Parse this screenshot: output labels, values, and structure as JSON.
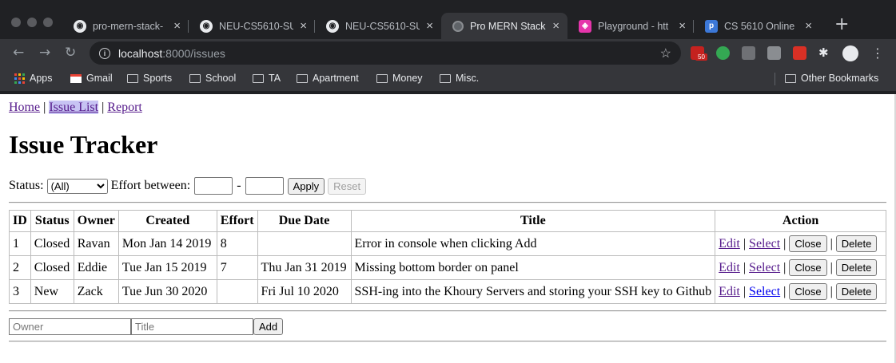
{
  "browser": {
    "tabs": [
      {
        "title": "pro-mern-stack-",
        "favicon": "github-icon",
        "active": false
      },
      {
        "title": "NEU-CS5610-SU",
        "favicon": "github-icon",
        "active": false
      },
      {
        "title": "NEU-CS5610-SU",
        "favicon": "github-icon",
        "active": false
      },
      {
        "title": "Pro MERN Stack",
        "favicon": "globe-icon",
        "active": true
      },
      {
        "title": "Playground - htt",
        "favicon": "graphql-icon",
        "active": false
      },
      {
        "title": "CS 5610 Online",
        "favicon": "piazza-icon",
        "active": false
      }
    ],
    "tab_close_glyph": "×",
    "new_tab_glyph": "+",
    "url_host": "localhost",
    "url_rest": ":8000/issues",
    "extension_badge": "50",
    "bookmarks": [
      {
        "label": "Apps",
        "icon": "apps-icon"
      },
      {
        "label": "Gmail",
        "icon": "gmail-icon"
      },
      {
        "label": "Sports",
        "icon": "folder-icon"
      },
      {
        "label": "School",
        "icon": "folder-icon"
      },
      {
        "label": "TA",
        "icon": "folder-icon"
      },
      {
        "label": "Apartment",
        "icon": "folder-icon"
      },
      {
        "label": "Money",
        "icon": "folder-icon"
      },
      {
        "label": "Misc.",
        "icon": "folder-icon"
      }
    ],
    "other_bookmarks": "Other Bookmarks",
    "colors": {
      "chrome_dark": "#202124",
      "toolbar": "#35363a"
    }
  },
  "page": {
    "nav": {
      "home": "Home",
      "sep1": "|",
      "issue_list": "Issue List",
      "sep2": "|",
      "report": "Report"
    },
    "title": "Issue Tracker",
    "filter": {
      "status_label": "Status:",
      "status_value": "(All)",
      "effort_label": "Effort between:",
      "dash": "-",
      "apply": "Apply",
      "reset": "Reset"
    },
    "table": {
      "headers": [
        "ID",
        "Status",
        "Owner",
        "Created",
        "Effort",
        "Due Date",
        "Title",
        "Action"
      ],
      "rows": [
        {
          "id": "1",
          "status": "Closed",
          "owner": "Ravan",
          "created": "Mon Jan 14 2019",
          "effort": "8",
          "due": "",
          "title": "Error in console when clicking Add"
        },
        {
          "id": "2",
          "status": "Closed",
          "owner": "Eddie",
          "created": "Tue Jan 15 2019",
          "effort": "7",
          "due": "Thu Jan 31 2019",
          "title": "Missing bottom border on panel"
        },
        {
          "id": "3",
          "status": "New",
          "owner": "Zack",
          "created": "Tue Jun 30 2020",
          "effort": "",
          "due": "Fri Jul 10 2020",
          "title": "SSH-ing into the Khoury Servers and storing your SSH key to Github"
        }
      ],
      "action_labels": {
        "edit": "Edit",
        "select": "Select",
        "close": "Close",
        "delete": "Delete",
        "sep": "|"
      }
    },
    "add_form": {
      "owner_placeholder": "Owner",
      "title_placeholder": "Title",
      "add": "Add"
    }
  }
}
